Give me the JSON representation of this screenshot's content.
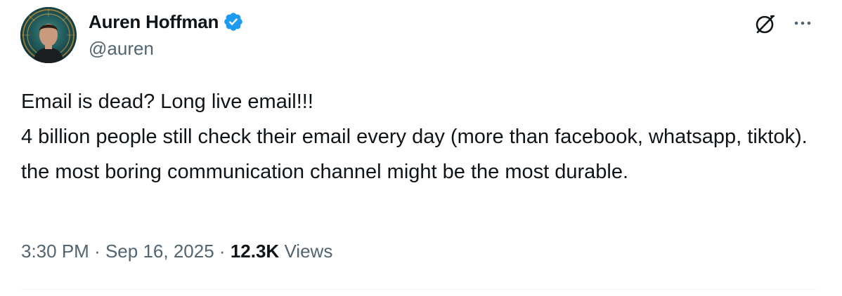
{
  "author": {
    "display_name": "Auren Hoffman",
    "handle": "@auren",
    "verified": true,
    "verified_color": "#1d9bf0"
  },
  "tweet": {
    "text": "Email is dead?  Long live email!!!\n4 billion people still check their email every day (more than facebook, whatsapp, tiktok). the most boring communication channel might be the most durable.",
    "time": "3:30 PM",
    "separator": "·",
    "date": "Sep 16, 2025",
    "views_count": "12.3K",
    "views_label": "Views"
  },
  "icons": {
    "grok": "grok-icon",
    "more": "more-options-icon"
  },
  "colors": {
    "text_primary": "#0f1419",
    "text_secondary": "#536471",
    "divider": "#eff3f4"
  }
}
